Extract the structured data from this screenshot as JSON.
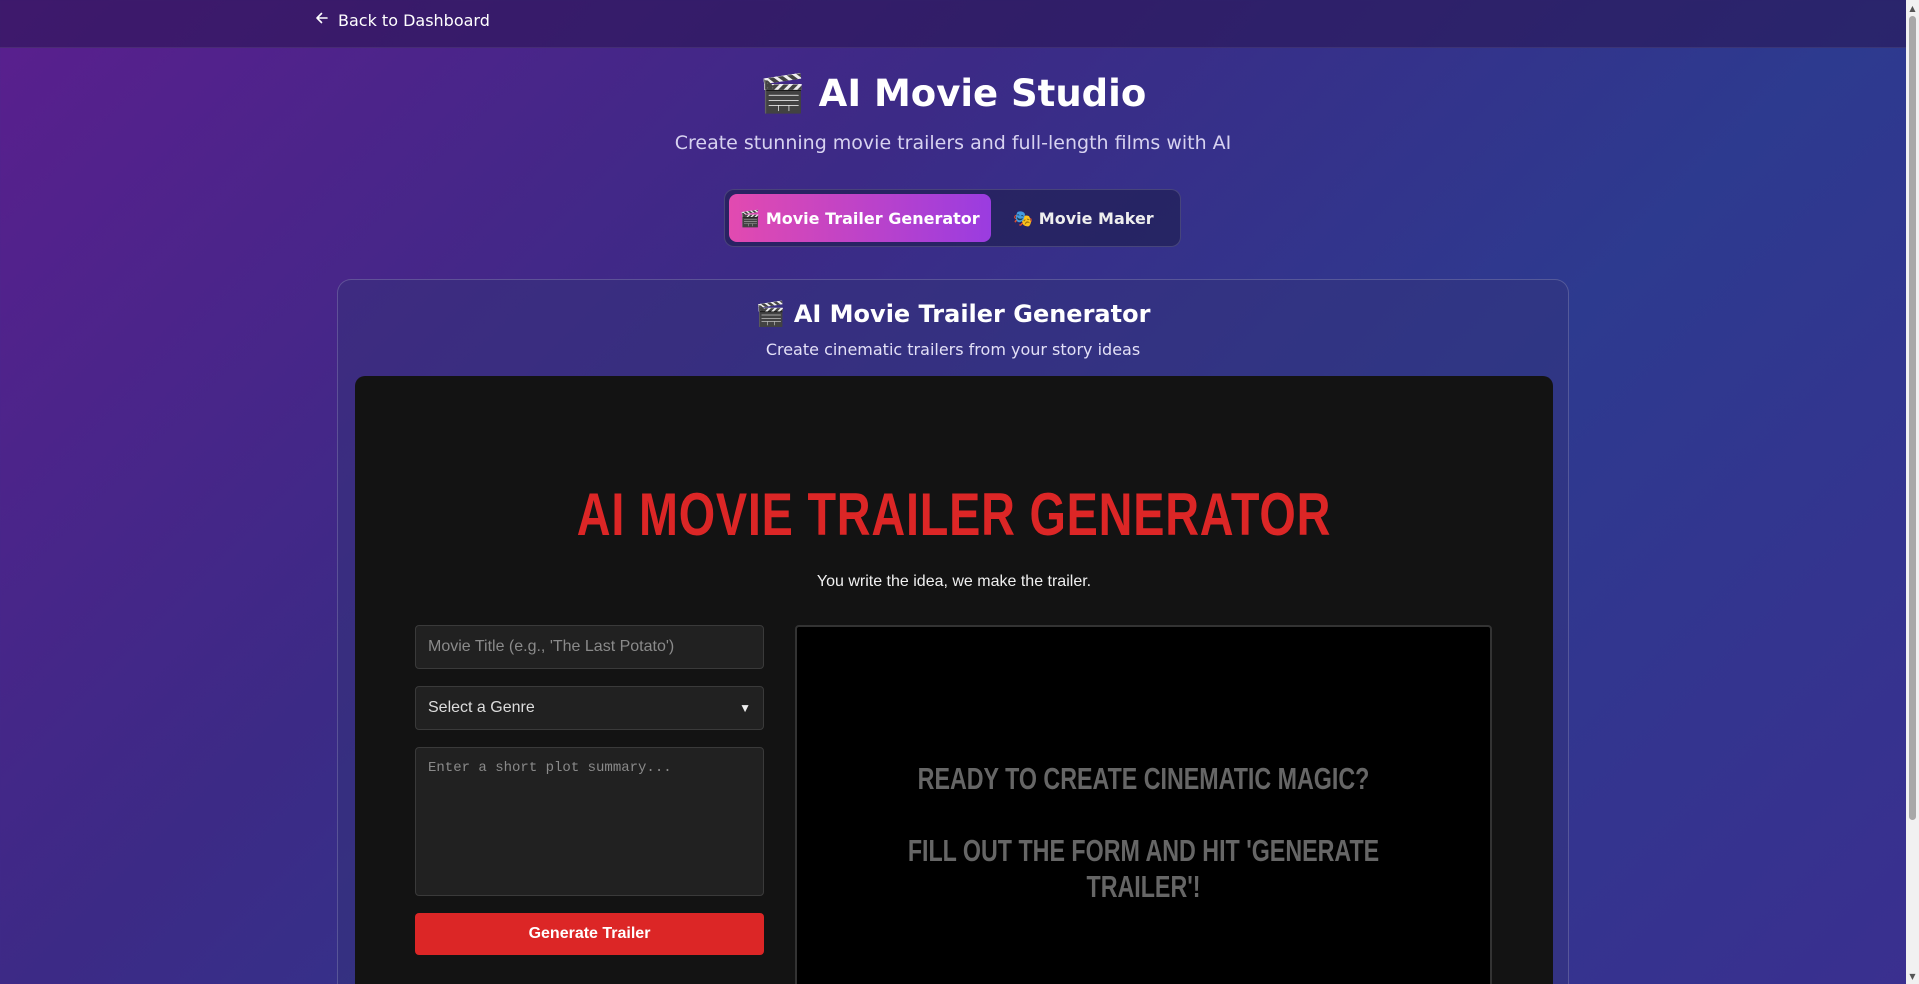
{
  "nav": {
    "back_label": "Back to Dashboard"
  },
  "header": {
    "title": "🎬 AI Movie Studio",
    "subtitle": "Create stunning movie trailers and full-length films with AI"
  },
  "tabs": [
    {
      "label": "🎬 Movie Trailer Generator",
      "active": true
    },
    {
      "label": "🎭 Movie Maker",
      "active": false
    }
  ],
  "panel": {
    "title": "🎬 AI Movie Trailer Generator",
    "subtitle": "Create cinematic trailers from your story ideas"
  },
  "app": {
    "title": "AI MOVIE TRAILER GENERATOR",
    "tagline": "You write the idea, we make the trailer.",
    "form": {
      "title_placeholder": "Movie Title (e.g., 'The Last Potato')",
      "title_value": "",
      "genre_selected": "Select a Genre",
      "plot_placeholder": "Enter a short plot summary...",
      "plot_value": "",
      "generate_label": "Generate Trailer"
    },
    "preview": {
      "line1": "READY TO CREATE CINEMATIC MAGIC?",
      "line2": "FILL OUT THE FORM AND HIT 'GENERATE TRAILER'!"
    }
  },
  "colors": {
    "accent_red": "#dc2626",
    "tab_gradient_start": "#e24ab0",
    "tab_gradient_end": "#9a3ce0"
  },
  "icons": {
    "back": "arrow-left-icon"
  }
}
